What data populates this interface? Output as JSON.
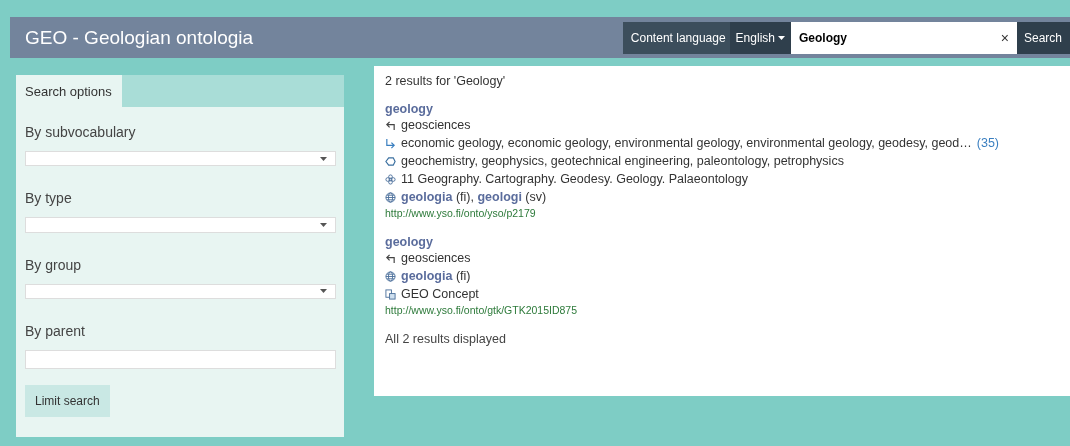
{
  "header": {
    "title": "GEO - Geologian ontologia",
    "content_language_label": "Content language",
    "language": "English",
    "search_value": "Geology",
    "clear": "×",
    "search_button": "Search"
  },
  "sidebar": {
    "tab": "Search options",
    "filters": [
      {
        "kind": "select",
        "label": "By subvocabulary"
      },
      {
        "kind": "select",
        "label": "By type"
      },
      {
        "kind": "select",
        "label": "By group"
      },
      {
        "kind": "text",
        "label": "By parent"
      }
    ],
    "button": "Limit search"
  },
  "results": {
    "summary": "2 results for 'Geology'",
    "items": [
      {
        "title": "geology",
        "lines": [
          {
            "kind": "broader",
            "text": "geosciences"
          },
          {
            "kind": "narrower",
            "text": "economic geology, economic geology, environmental geology, environmental geology, geodesy, geod…",
            "more": "(35)"
          },
          {
            "kind": "related",
            "text": "geochemistry, geophysics, geotechnical engineering, paleontology, petrophysics"
          },
          {
            "kind": "group",
            "text": "11 Geography. Cartography. Geodesy. Geology. Palaeontology"
          },
          {
            "kind": "labels",
            "text": "**geologia** (fi), **geologi** (sv)"
          }
        ],
        "uri": "http://www.yso.fi/onto/yso/p2179"
      },
      {
        "title": "geology",
        "lines": [
          {
            "kind": "broader",
            "text": "geosciences"
          },
          {
            "kind": "labels",
            "text": "**geologia** (fi)"
          },
          {
            "kind": "type",
            "text": "GEO Concept"
          }
        ],
        "uri": "http://www.yso.fi/onto/gtk/GTK2015ID875"
      }
    ],
    "footer": "All 2 results displayed"
  }
}
